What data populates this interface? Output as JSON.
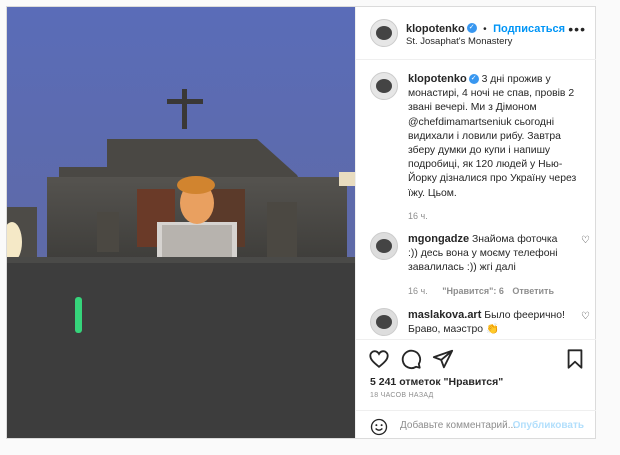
{
  "post": {
    "username": "klopotenko",
    "follow_label": "Подписаться",
    "separator": "•",
    "location": "St. Josaphat's Monastery",
    "more_label": "•••",
    "caption": "3 дні прожив у монастирі, 4 ночі не спав, провів 2 звані вечері. Ми з Дімоном @chefdimamartseniuk сьогодні видихали і ловили рибу. Завтра зберу думки до купи і напишу подробиці, як 120 людей у Нью-Йорку дізналися про Україну через їжу. Цьом.",
    "caption_time": "16 ч."
  },
  "comments": [
    {
      "username": "mgongadze",
      "text": "Знайома фоточка :)) десь вона у моєму телефоні завалилась :)) жгі далі",
      "time": "16 ч.",
      "likes_label": "\"Нравится\": 6",
      "reply_label": "Ответить"
    },
    {
      "username": "maslakova.art",
      "text": "Было феерично! Браво, маэстро 👏",
      "time": "",
      "likes_label": "",
      "reply_label": ""
    }
  ],
  "stats": {
    "likes_count": "5 241",
    "likes_rest": "отметок \"Нравится\"",
    "posted_ago": "18 ЧАСОВ НАЗАД"
  },
  "composer": {
    "placeholder": "Добавьте комментарий...",
    "publish_label": "Опубликовать"
  },
  "icons": {
    "like": "heart-icon",
    "comment": "comment-icon",
    "share": "share-icon",
    "save": "bookmark-icon",
    "emoji": "emoji-icon"
  },
  "colors": {
    "link_blue": "#0095f6",
    "verified_blue": "#3897f0",
    "muted": "#8e8e8e"
  }
}
